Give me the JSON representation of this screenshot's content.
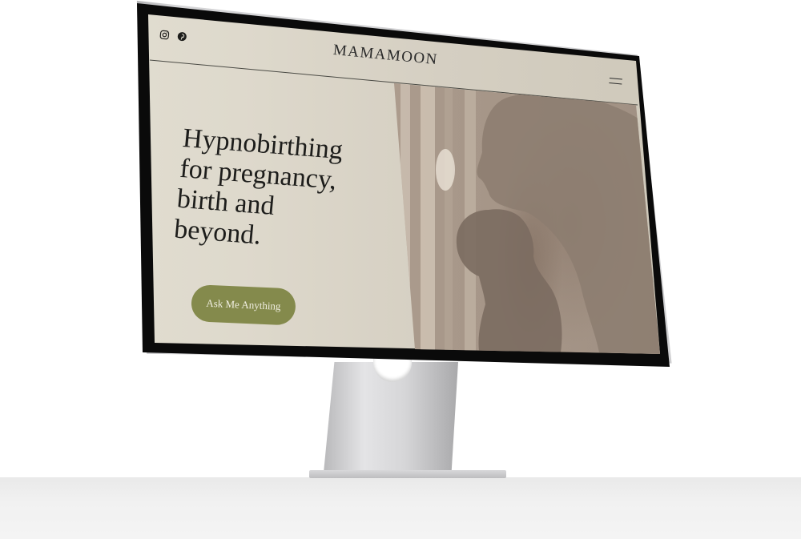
{
  "header": {
    "brand": "MAMAMOON",
    "social": [
      {
        "icon": "instagram-icon"
      },
      {
        "icon": "pinterest-icon"
      }
    ],
    "menu_icon": "hamburger-menu-icon"
  },
  "hero": {
    "headline_lines": [
      "Hypnobirthing",
      "for pregnancy,",
      "birth and",
      "beyond."
    ],
    "cta_label": "Ask Me Anything",
    "image": "silhouette of mother holding child behind sheer curtain"
  },
  "colors": {
    "background": "#e3e0d4",
    "cta": "#848a4c",
    "text": "#1d1d1b"
  }
}
